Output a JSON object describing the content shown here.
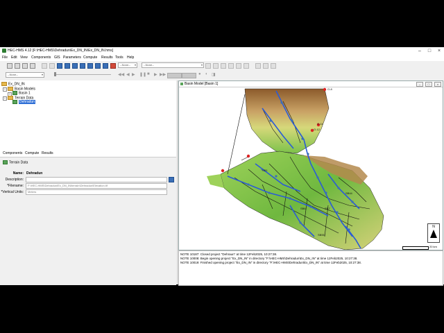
{
  "window": {
    "title": "HEC-HMS 4.12 [F:\\HEC-HMS\\Dehradun\\Ex_DN_IN\\Ex_DN_IN.hms]",
    "minimize": "–",
    "maximize": "□",
    "close": "×"
  },
  "menu": [
    "File",
    "Edit",
    "View",
    "Components",
    "GIS",
    "Parameters",
    "Compute",
    "Results",
    "Tools",
    "Help"
  ],
  "toolbar": {
    "combo1": "--None--",
    "combo2": "--None--",
    "combo3": "--None--"
  },
  "tree": {
    "project": "Ex_DN_IN",
    "basin_models": "Basin Models",
    "basin1": "Basin 1",
    "terrain_data": "Terrain Data",
    "dehradun": "Dehradun"
  },
  "tabs": [
    "Components",
    "Compute",
    "Results"
  ],
  "component_panel": {
    "title": "Terrain Data",
    "name_label": "Name:",
    "name_value": "Dehradun",
    "description_label": "Description:",
    "description_value": "",
    "filename_label": "*Filename:",
    "filename_value": "F:\\HEC-HMS\\Dehradun\\Ex_DN_IN\\terrain\\Dehradun\\Elevation.tif",
    "vertical_units_label": "*Vertical Units:",
    "vertical_units_value": "Meters"
  },
  "basin_window": {
    "title": "Basin Model [Basin 1]",
    "labels": [
      "O-8",
      "O-11",
      "O-12",
      "SB1",
      "SB44",
      "SB55",
      "SB6",
      "SB7"
    ],
    "north": "N",
    "scale": "20 km"
  },
  "log": [
    "NOTE 10187:  Closed project \"Dehraun\" at time 12Feb2025, 10:27:38.",
    "NOTE 10008:  Begin opening project \"Ex_DN_IN\" in directory \"F:\\HEC-HMS\\Dehradun\\Ex_DN_IN\" at time 12Feb2025, 10:27:38.",
    "NOTE 10019:  Finished opening project \"Ex_DN_IN\" in directory \"F:\\HEC-HMS\\Dehradun\\Ex_DN_IN\" at time 12Feb2025, 10:27:38."
  ],
  "colors": {
    "selection": "#2f6fd6",
    "terrain_low": "#7cc24a",
    "terrain_high": "#8b5a2b",
    "river": "#2a5bd7"
  }
}
